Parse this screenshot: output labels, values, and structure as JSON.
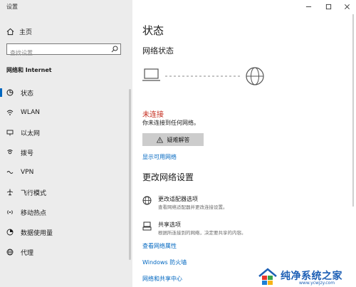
{
  "window": {
    "title": "设置"
  },
  "sidebar": {
    "home_label": "主页",
    "search_placeholder": "查找设置",
    "section_title": "网络和 Internet",
    "items": [
      {
        "label": "状态",
        "icon": "status-icon",
        "active": true
      },
      {
        "label": "WLAN",
        "icon": "wifi-icon"
      },
      {
        "label": "以太网",
        "icon": "ethernet-icon"
      },
      {
        "label": "拨号",
        "icon": "dialup-icon"
      },
      {
        "label": "VPN",
        "icon": "vpn-icon"
      },
      {
        "label": "飞行模式",
        "icon": "airplane-icon"
      },
      {
        "label": "移动热点",
        "icon": "hotspot-icon"
      },
      {
        "label": "数据使用量",
        "icon": "data-usage-icon"
      },
      {
        "label": "代理",
        "icon": "globe-icon"
      }
    ]
  },
  "main": {
    "title": "状态",
    "network_status_heading": "网络状态",
    "status_text": "未连接",
    "status_description": "你未连接到任何网络。",
    "troubleshoot_label": "疑难解答",
    "show_networks_link": "显示可用网络",
    "change_settings_heading": "更改网络设置",
    "options": [
      {
        "title": "更改适配器选项",
        "description": "查看网络适配器并更改连接设置。",
        "icon": "adapter-icon"
      },
      {
        "title": "共享选项",
        "description": "根据所连接到的网络，决定要共享的内容。",
        "icon": "sharing-icon"
      }
    ],
    "links": [
      "查看网络属性",
      "Windows 防火墙",
      "网络和共享中心"
    ]
  },
  "watermark": {
    "text": "纯净系统之家",
    "url": "www.ycwjzy.com"
  },
  "colors": {
    "accent": "#0067c0",
    "error": "#c42b1c",
    "sidebar_bg": "#ececec"
  }
}
